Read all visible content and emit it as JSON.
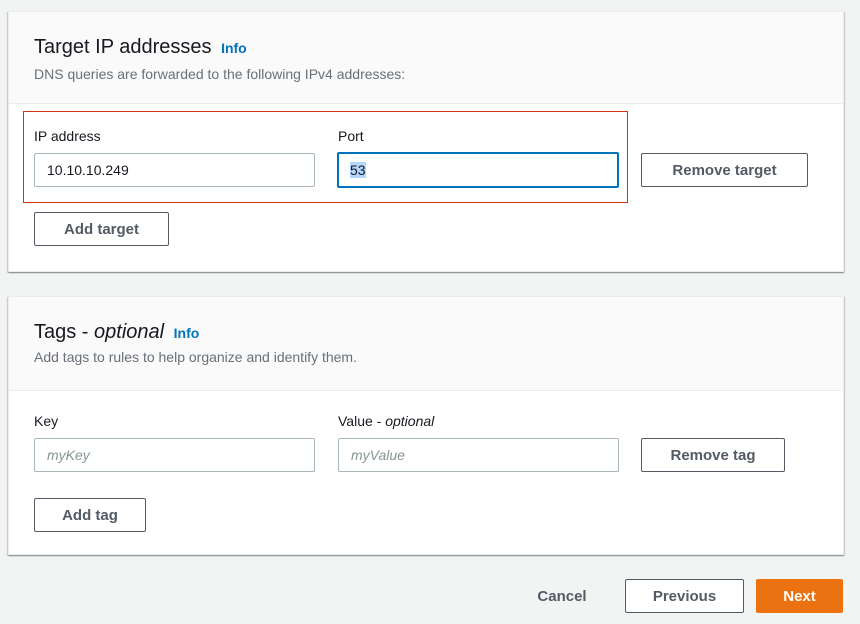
{
  "target_section": {
    "title": "Target IP addresses",
    "info": "Info",
    "description": "DNS queries are forwarded to the following IPv4 addresses:",
    "ip_label": "IP address",
    "ip_value": "10.10.10.249",
    "port_label": "Port",
    "port_value": "53",
    "remove_button": "Remove target",
    "add_button": "Add target"
  },
  "tags_section": {
    "title_main": "Tags - ",
    "title_optional": "optional",
    "info": "Info",
    "description": "Add tags to rules to help organize and identify them.",
    "key_label": "Key",
    "key_placeholder": "myKey",
    "value_label_main": "Value - ",
    "value_label_optional": "optional",
    "value_placeholder": "myValue",
    "remove_button": "Remove tag",
    "add_button": "Add tag"
  },
  "footer": {
    "cancel": "Cancel",
    "previous": "Previous",
    "next": "Next"
  },
  "colors": {
    "primary": "#ec7211",
    "link": "#0073bb",
    "focus": "#0073bb",
    "highlight_box": "#d13212"
  }
}
